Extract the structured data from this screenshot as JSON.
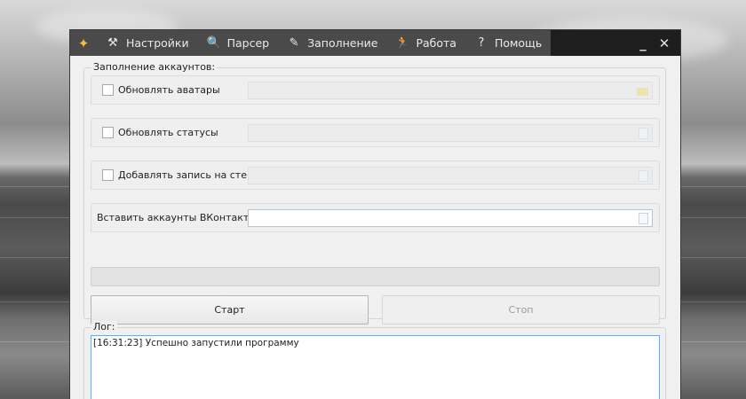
{
  "menu": {
    "items": [
      {
        "label": "Настройки",
        "icon": "tools-icon"
      },
      {
        "label": "Парсер",
        "icon": "magnifier-icon"
      },
      {
        "label": "Заполнение",
        "icon": "fill-icon"
      },
      {
        "label": "Работа",
        "icon": "runner-icon"
      },
      {
        "label": "Помощь",
        "icon": "help-icon"
      }
    ]
  },
  "window_controls": {
    "minimize": "_",
    "close": "✕"
  },
  "group": {
    "title": "Заполнение аккаунтов:",
    "rows": [
      {
        "label": "Обновлять аватары",
        "checked": false,
        "value": ""
      },
      {
        "label": "Обновлять статусы",
        "checked": false,
        "value": ""
      },
      {
        "label": "Добавлять запись на стену",
        "checked": false,
        "value": ""
      },
      {
        "label": "Вставить аккаунты ВКонтакте",
        "value": ""
      }
    ],
    "start_label": "Старт",
    "stop_label": "Стоп"
  },
  "log": {
    "title": "Лог:",
    "entries": [
      "[16:31:23] Успешно запустили программу"
    ]
  }
}
